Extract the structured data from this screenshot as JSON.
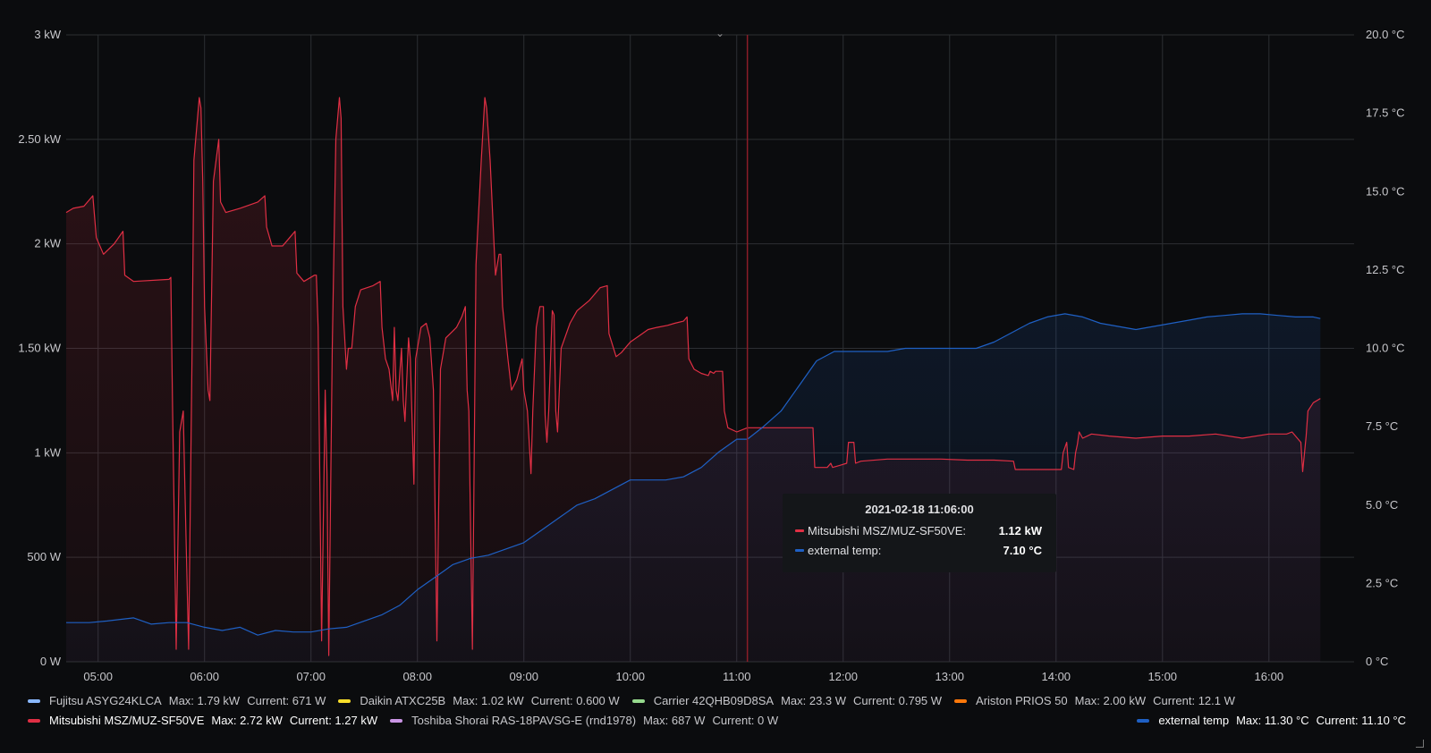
{
  "chart_data": {
    "type": "area",
    "x_axis": {
      "unit": "time",
      "date": "2021-02-18",
      "range": [
        "04:42",
        "16:48"
      ],
      "ticks": [
        "05:00",
        "06:00",
        "07:00",
        "08:00",
        "09:00",
        "10:00",
        "11:00",
        "12:00",
        "13:00",
        "14:00",
        "15:00",
        "16:00"
      ]
    },
    "y_left": {
      "ylim": [
        0,
        3000
      ],
      "tick_values": [
        0,
        500,
        1000,
        1500,
        2000,
        2500,
        3000
      ],
      "tick_labels": [
        "0 W",
        "500 W",
        "1 kW",
        "1.50 kW",
        "2 kW",
        "2.50 kW",
        "3 kW"
      ]
    },
    "y_right": {
      "ylim": [
        0,
        20
      ],
      "tick_values": [
        0,
        2.5,
        5,
        7.5,
        10,
        12.5,
        15,
        17.5,
        20
      ],
      "tick_labels": [
        "0 °C",
        "2.5 °C",
        "5.0 °C",
        "7.5 °C",
        "10.0 °C",
        "12.5 °C",
        "15.0 °C",
        "17.5 °C",
        "20.0 °C"
      ]
    },
    "grid": true,
    "series": [
      {
        "name": "Mitsubishi MSZ/MUZ-SF50VE",
        "color": "#e02f44",
        "axis": "left",
        "points": [
          [
            "04:42",
            2150
          ],
          [
            "04:46",
            2170
          ],
          [
            "04:52",
            2180
          ],
          [
            "04:57",
            2230
          ],
          [
            "04:59",
            2030
          ],
          [
            "05:03",
            1950
          ],
          [
            "05:09",
            2000
          ],
          [
            "05:14",
            2060
          ],
          [
            "05:15",
            1850
          ],
          [
            "05:20",
            1820
          ],
          [
            "05:40",
            1830
          ],
          [
            "05:41",
            1840
          ],
          [
            "05:42",
            1200
          ],
          [
            "05:44",
            60
          ],
          [
            "05:46",
            1100
          ],
          [
            "05:48",
            1200
          ],
          [
            "05:49",
            800
          ],
          [
            "05:51",
            60
          ],
          [
            "05:53",
            1500
          ],
          [
            "05:54",
            2400
          ],
          [
            "05:57",
            2700
          ],
          [
            "05:58",
            2650
          ],
          [
            "05:59",
            2300
          ],
          [
            "06:00",
            1700
          ],
          [
            "06:02",
            1300
          ],
          [
            "06:03",
            1250
          ],
          [
            "06:05",
            2300
          ],
          [
            "06:08",
            2500
          ],
          [
            "06:09",
            2200
          ],
          [
            "06:12",
            2150
          ],
          [
            "06:20",
            2170
          ],
          [
            "06:30",
            2200
          ],
          [
            "06:34",
            2230
          ],
          [
            "06:35",
            2080
          ],
          [
            "06:38",
            1990
          ],
          [
            "06:44",
            1990
          ],
          [
            "06:48",
            2030
          ],
          [
            "06:51",
            2060
          ],
          [
            "06:52",
            1860
          ],
          [
            "06:56",
            1820
          ],
          [
            "07:02",
            1850
          ],
          [
            "07:03",
            1850
          ],
          [
            "07:04",
            1600
          ],
          [
            "07:06",
            100
          ],
          [
            "07:08",
            1300
          ],
          [
            "07:09",
            900
          ],
          [
            "07:10",
            30
          ],
          [
            "07:12",
            1500
          ],
          [
            "07:14",
            2500
          ],
          [
            "07:16",
            2700
          ],
          [
            "07:17",
            2600
          ],
          [
            "07:18",
            1700
          ],
          [
            "07:20",
            1400
          ],
          [
            "07:21",
            1500
          ],
          [
            "07:23",
            1500
          ],
          [
            "07:25",
            1700
          ],
          [
            "07:28",
            1780
          ],
          [
            "07:35",
            1800
          ],
          [
            "07:39",
            1820
          ],
          [
            "07:40",
            1600
          ],
          [
            "07:42",
            1450
          ],
          [
            "07:44",
            1400
          ],
          [
            "07:46",
            1250
          ],
          [
            "07:47",
            1600
          ],
          [
            "07:48",
            1300
          ],
          [
            "07:49",
            1250
          ],
          [
            "07:51",
            1500
          ],
          [
            "07:52",
            1250
          ],
          [
            "07:53",
            1150
          ],
          [
            "07:55",
            1550
          ],
          [
            "07:56",
            1450
          ],
          [
            "07:58",
            850
          ],
          [
            "07:59",
            1450
          ],
          [
            "08:02",
            1600
          ],
          [
            "08:05",
            1620
          ],
          [
            "08:07",
            1550
          ],
          [
            "08:09",
            1300
          ],
          [
            "08:11",
            100
          ],
          [
            "08:13",
            1400
          ],
          [
            "08:16",
            1550
          ],
          [
            "08:22",
            1600
          ],
          [
            "08:25",
            1650
          ],
          [
            "08:27",
            1700
          ],
          [
            "08:28",
            1300
          ],
          [
            "08:29",
            1200
          ],
          [
            "08:31",
            60
          ],
          [
            "08:33",
            1900
          ],
          [
            "08:36",
            2400
          ],
          [
            "08:38",
            2700
          ],
          [
            "08:39",
            2650
          ],
          [
            "08:41",
            2400
          ],
          [
            "08:44",
            1850
          ],
          [
            "08:46",
            1950
          ],
          [
            "08:47",
            1950
          ],
          [
            "08:48",
            1700
          ],
          [
            "08:51",
            1450
          ],
          [
            "08:53",
            1300
          ],
          [
            "08:56",
            1350
          ],
          [
            "08:59",
            1450
          ],
          [
            "09:00",
            1300
          ],
          [
            "09:02",
            1200
          ],
          [
            "09:04",
            900
          ],
          [
            "09:05",
            1200
          ],
          [
            "09:07",
            1600
          ],
          [
            "09:09",
            1700
          ],
          [
            "09:11",
            1700
          ],
          [
            "09:12",
            1180
          ],
          [
            "09:13",
            1050
          ],
          [
            "09:14",
            1200
          ],
          [
            "09:16",
            1680
          ],
          [
            "09:17",
            1660
          ],
          [
            "09:18",
            1200
          ],
          [
            "09:19",
            1100
          ],
          [
            "09:21",
            1500
          ],
          [
            "09:26",
            1620
          ],
          [
            "09:30",
            1680
          ],
          [
            "09:37",
            1730
          ],
          [
            "09:43",
            1790
          ],
          [
            "09:47",
            1800
          ],
          [
            "09:48",
            1570
          ],
          [
            "09:52",
            1460
          ],
          [
            "09:55",
            1480
          ],
          [
            "10:00",
            1530
          ],
          [
            "10:05",
            1560
          ],
          [
            "10:10",
            1590
          ],
          [
            "10:15",
            1600
          ],
          [
            "10:21",
            1610
          ],
          [
            "10:25",
            1620
          ],
          [
            "10:30",
            1630
          ],
          [
            "10:32",
            1650
          ],
          [
            "10:33",
            1450
          ],
          [
            "10:36",
            1400
          ],
          [
            "10:40",
            1380
          ],
          [
            "10:44",
            1370
          ],
          [
            "10:45",
            1390
          ],
          [
            "10:47",
            1380
          ],
          [
            "10:48",
            1390
          ],
          [
            "10:50",
            1390
          ],
          [
            "10:52",
            1390
          ],
          [
            "10:53",
            1200
          ],
          [
            "10:55",
            1120
          ],
          [
            "11:00",
            1100
          ],
          [
            "11:06",
            1120
          ],
          [
            "11:10",
            1120
          ],
          [
            "11:20",
            1120
          ],
          [
            "11:35",
            1120
          ],
          [
            "11:43",
            1120
          ],
          [
            "11:44",
            930
          ],
          [
            "11:51",
            930
          ],
          [
            "11:53",
            950
          ],
          [
            "11:54",
            930
          ],
          [
            "11:58",
            940
          ],
          [
            "12:02",
            950
          ],
          [
            "12:03",
            1050
          ],
          [
            "12:06",
            1050
          ],
          [
            "12:07",
            950
          ],
          [
            "12:10",
            960
          ],
          [
            "12:25",
            970
          ],
          [
            "12:40",
            970
          ],
          [
            "12:55",
            970
          ],
          [
            "13:10",
            965
          ],
          [
            "13:25",
            965
          ],
          [
            "13:36",
            960
          ],
          [
            "13:37",
            920
          ],
          [
            "13:45",
            920
          ],
          [
            "13:55",
            920
          ],
          [
            "14:03",
            920
          ],
          [
            "14:04",
            1000
          ],
          [
            "14:06",
            1050
          ],
          [
            "14:07",
            930
          ],
          [
            "14:10",
            920
          ],
          [
            "14:11",
            1000
          ],
          [
            "14:12",
            1040
          ],
          [
            "14:13",
            1100
          ],
          [
            "14:15",
            1070
          ],
          [
            "14:20",
            1090
          ],
          [
            "14:30",
            1080
          ],
          [
            "14:45",
            1070
          ],
          [
            "15:00",
            1080
          ],
          [
            "15:15",
            1080
          ],
          [
            "15:30",
            1090
          ],
          [
            "15:45",
            1070
          ],
          [
            "16:00",
            1090
          ],
          [
            "16:10",
            1090
          ],
          [
            "16:13",
            1100
          ],
          [
            "16:18",
            1050
          ],
          [
            "16:19",
            910
          ],
          [
            "16:21",
            1080
          ],
          [
            "16:22",
            1200
          ],
          [
            "16:25",
            1240
          ],
          [
            "16:29",
            1260
          ]
        ]
      },
      {
        "name": "external temp",
        "color": "#1f60c4",
        "axis": "right",
        "points": [
          [
            "04:42",
            1.25
          ],
          [
            "04:55",
            1.25
          ],
          [
            "05:05",
            1.3
          ],
          [
            "05:20",
            1.4
          ],
          [
            "05:30",
            1.2
          ],
          [
            "05:40",
            1.25
          ],
          [
            "05:50",
            1.25
          ],
          [
            "06:00",
            1.1
          ],
          [
            "06:10",
            1.0
          ],
          [
            "06:20",
            1.1
          ],
          [
            "06:30",
            0.85
          ],
          [
            "06:40",
            1.0
          ],
          [
            "06:50",
            0.95
          ],
          [
            "07:00",
            0.95
          ],
          [
            "07:10",
            1.05
          ],
          [
            "07:20",
            1.1
          ],
          [
            "07:30",
            1.3
          ],
          [
            "07:40",
            1.5
          ],
          [
            "07:50",
            1.8
          ],
          [
            "08:00",
            2.3
          ],
          [
            "08:10",
            2.7
          ],
          [
            "08:20",
            3.1
          ],
          [
            "08:30",
            3.3
          ],
          [
            "08:40",
            3.4
          ],
          [
            "08:50",
            3.6
          ],
          [
            "09:00",
            3.8
          ],
          [
            "09:10",
            4.2
          ],
          [
            "09:20",
            4.6
          ],
          [
            "09:30",
            5.0
          ],
          [
            "09:40",
            5.2
          ],
          [
            "09:50",
            5.5
          ],
          [
            "10:00",
            5.8
          ],
          [
            "10:10",
            5.8
          ],
          [
            "10:20",
            5.8
          ],
          [
            "10:30",
            5.9
          ],
          [
            "10:40",
            6.2
          ],
          [
            "10:50",
            6.7
          ],
          [
            "11:00",
            7.1
          ],
          [
            "11:06",
            7.1
          ],
          [
            "11:15",
            7.5
          ],
          [
            "11:25",
            8.0
          ],
          [
            "11:35",
            8.8
          ],
          [
            "11:45",
            9.6
          ],
          [
            "11:55",
            9.9
          ],
          [
            "12:05",
            9.9
          ],
          [
            "12:15",
            9.9
          ],
          [
            "12:25",
            9.9
          ],
          [
            "12:35",
            10.0
          ],
          [
            "12:45",
            10.0
          ],
          [
            "12:55",
            10.0
          ],
          [
            "13:05",
            10.0
          ],
          [
            "13:15",
            10.0
          ],
          [
            "13:25",
            10.2
          ],
          [
            "13:35",
            10.5
          ],
          [
            "13:45",
            10.8
          ],
          [
            "13:55",
            11.0
          ],
          [
            "14:05",
            11.1
          ],
          [
            "14:15",
            11.0
          ],
          [
            "14:25",
            10.8
          ],
          [
            "14:35",
            10.7
          ],
          [
            "14:45",
            10.6
          ],
          [
            "14:55",
            10.7
          ],
          [
            "15:05",
            10.8
          ],
          [
            "15:15",
            10.9
          ],
          [
            "15:25",
            11.0
          ],
          [
            "15:35",
            11.05
          ],
          [
            "15:45",
            11.1
          ],
          [
            "15:55",
            11.1
          ],
          [
            "16:05",
            11.05
          ],
          [
            "16:15",
            11.0
          ],
          [
            "16:25",
            11.0
          ],
          [
            "16:29",
            10.95
          ]
        ]
      }
    ]
  },
  "cursor": {
    "time": "11:06"
  },
  "tooltip": {
    "time": "2021-02-18 11:06:00",
    "rows": [
      {
        "label": "Mitsubishi MSZ/MUZ-SF50VE:",
        "value": "1.12 kW",
        "color": "#e02f44"
      },
      {
        "label": "external temp:",
        "value": "7.10 °C",
        "color": "#1f60c4"
      }
    ]
  },
  "legend": {
    "row1": [
      {
        "name": "Fujitsu ASYG24KLCA",
        "max": "Max: 1.79 kW",
        "current": "Current: 671 W",
        "color": "#8ab8ff"
      },
      {
        "name": "Daikin ATXC25B",
        "max": "Max: 1.02 kW",
        "current": "Current: 0.600 W",
        "color": "#fade2a"
      },
      {
        "name": "Carrier 42QHB09D8SA",
        "max": "Max: 23.3 W",
        "current": "Current: 0.795 W",
        "color": "#96d98d"
      },
      {
        "name": "Ariston PRIOS 50",
        "max": "Max: 2.00 kW",
        "current": "Current: 12.1 W",
        "color": "#ff780a"
      }
    ],
    "row2": [
      {
        "name": "Mitsubishi MSZ/MUZ-SF50VE",
        "max": "Max: 2.72 kW",
        "current": "Current: 1.27 kW",
        "color": "#e02f44"
      },
      {
        "name": "Toshiba Shorai RAS-18PAVSG-E (rnd1978)",
        "max": "Max: 687 W",
        "current": "Current: 0 W",
        "color": "#ca95e5"
      }
    ],
    "right": {
      "name": "external temp",
      "max": "Max: 11.30 °C",
      "current": "Current: 11.10 °C",
      "color": "#1f60c4"
    }
  }
}
